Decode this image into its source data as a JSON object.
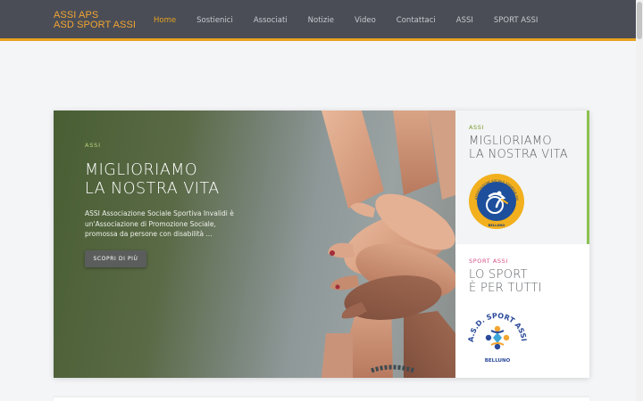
{
  "brand": {
    "line1": "ASSI APS",
    "line2": "ASD SPORT ASSI"
  },
  "nav": [
    {
      "label": "Home",
      "active": true
    },
    {
      "label": "Sostienici",
      "active": false
    },
    {
      "label": "Associati",
      "active": false
    },
    {
      "label": "Notizie",
      "active": false
    },
    {
      "label": "Video",
      "active": false
    },
    {
      "label": "Contattaci",
      "active": false
    },
    {
      "label": "ASSI",
      "active": false
    },
    {
      "label": "SPORT ASSI",
      "active": false
    }
  ],
  "hero": {
    "eyebrow": "ASSI",
    "title_line1": "MIGLIORIAMO",
    "title_line2": "LA NOSTRA VITA",
    "description": "ASSI Associazione Sociale Sportiva Invalidi è un'Associazione di Promozione Sociale, promossa da persone con disabilità ...",
    "button_label": "SCOPRI DI PIÙ"
  },
  "cards": [
    {
      "eyebrow": "ASSI",
      "title_line1": "MIGLIORIAMO",
      "title_line2": "LA NOSTRA VITA",
      "logo_ring_text": "ASSOCIAZIONE SOCIALE SPORTIVA INVALIDI",
      "logo_bottom_text": "BELLUNO"
    },
    {
      "eyebrow": "SPORT ASSI",
      "title_line1": "LO SPORT",
      "title_line2": "È PER TUTTI",
      "logo_arc_text": "A.S.D. SPORT ASSI",
      "logo_bottom_text": "BELLUNO"
    }
  ],
  "colors": {
    "accent": "#e6a11f",
    "nav_bg": "#4a4d56",
    "green_accent": "#8cc152",
    "pink_accent": "#d64f86"
  }
}
